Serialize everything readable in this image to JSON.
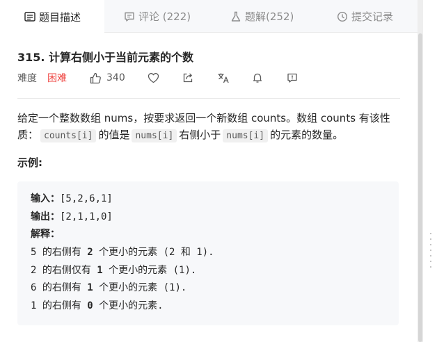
{
  "tabs": [
    {
      "label": "题目描述",
      "icon": "description-icon",
      "active": true
    },
    {
      "label": "评论 (222)",
      "icon": "comment-icon",
      "active": false
    },
    {
      "label": "题解(252)",
      "icon": "flask-icon",
      "active": false
    },
    {
      "label": "提交记录",
      "icon": "clock-icon",
      "active": false
    }
  ],
  "problem": {
    "title": "315. 计算右侧小于当前元素的个数",
    "difficulty_label": "难度",
    "difficulty": "困难",
    "likes": "340"
  },
  "description": {
    "part1": "给定一个整数数组 nums，按要求返回一个新数组 counts。数组 counts 有该性质：",
    "code1": "counts[i]",
    "part2": "的值是",
    "code2": "nums[i]",
    "part3": "右侧小于",
    "code3": "nums[i]",
    "part4": "的元素的数量。"
  },
  "example": {
    "label": "示例:",
    "input_label": "输入：",
    "input_value": "[5,2,6,1]",
    "output_label": "输出：",
    "output_value": "[2,1,1,0]",
    "explain_label": "解释：",
    "lines": [
      {
        "pre": "5 的右侧有 ",
        "num": "2",
        "post": " 个更小的元素 (2 和 1)."
      },
      {
        "pre": "2 的右侧仅有 ",
        "num": "1",
        "post": " 个更小的元素 (1)."
      },
      {
        "pre": "6 的右侧有 ",
        "num": "1",
        "post": " 个更小的元素 (1)."
      },
      {
        "pre": "1 的右侧有 ",
        "num": "0",
        "post": " 个更小的元素."
      }
    ]
  },
  "colors": {
    "hard": "#ef4743",
    "code_bg": "#f0f0f0",
    "example_bg": "#f7f8fa"
  }
}
